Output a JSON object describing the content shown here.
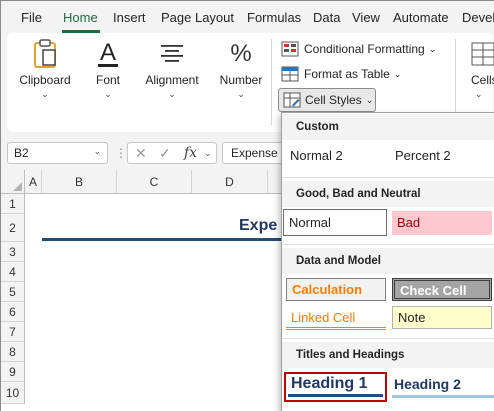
{
  "ribbon_tabs": [
    "File",
    "Home",
    "Insert",
    "Page Layout",
    "Formulas",
    "Data",
    "View",
    "Automate",
    "Devel"
  ],
  "active_tab": "Home",
  "ribbon_groups": {
    "clipboard": "Clipboard",
    "font": "Font",
    "alignment": "Alignment",
    "number": "Number",
    "cells": "Cells"
  },
  "styles_group": {
    "conditional_formatting": "Conditional Formatting",
    "format_as_table": "Format as Table",
    "cell_styles": "Cell Styles"
  },
  "formula_bar": {
    "name_box": "B2",
    "fx_symbol": "fx",
    "content": "Expense"
  },
  "grid": {
    "columns": [
      "A",
      "B",
      "C",
      "D"
    ],
    "rows": [
      "1",
      "2",
      "3",
      "4",
      "5",
      "6",
      "7",
      "8",
      "9",
      "10"
    ],
    "b2_text": "Expe"
  },
  "cell_styles_menu": {
    "sections": {
      "custom": "Custom",
      "good_bad_neutral": "Good, Bad and Neutral",
      "data_model": "Data and Model",
      "titles_headings": "Titles and Headings"
    },
    "custom_styles": [
      "Normal 2",
      "Percent 2"
    ],
    "good_bad_neutral_styles": [
      "Normal",
      "Bad"
    ],
    "data_model_styles": [
      "Calculation",
      "Check Cell",
      "Linked Cell",
      "Note"
    ],
    "titles_styles": [
      "Heading 1",
      "Heading 2"
    ]
  },
  "colors": {
    "accent": "#1b6b3e",
    "bad_bg": "#ffc7ce",
    "bad_fg": "#9c0006",
    "calculation_fg": "#fa7d00",
    "check_cell_bg": "#a5a5a5",
    "note_bg": "#ffffcc",
    "heading_fg": "#1f3864",
    "hover_border": "#c00000"
  },
  "icons": [
    "clipboard-icon",
    "font-icon",
    "alignment-icon",
    "percent-icon",
    "conditional-formatting-icon",
    "format-as-table-icon",
    "cell-styles-icon",
    "cells-icon",
    "cancel-icon",
    "enter-icon"
  ]
}
